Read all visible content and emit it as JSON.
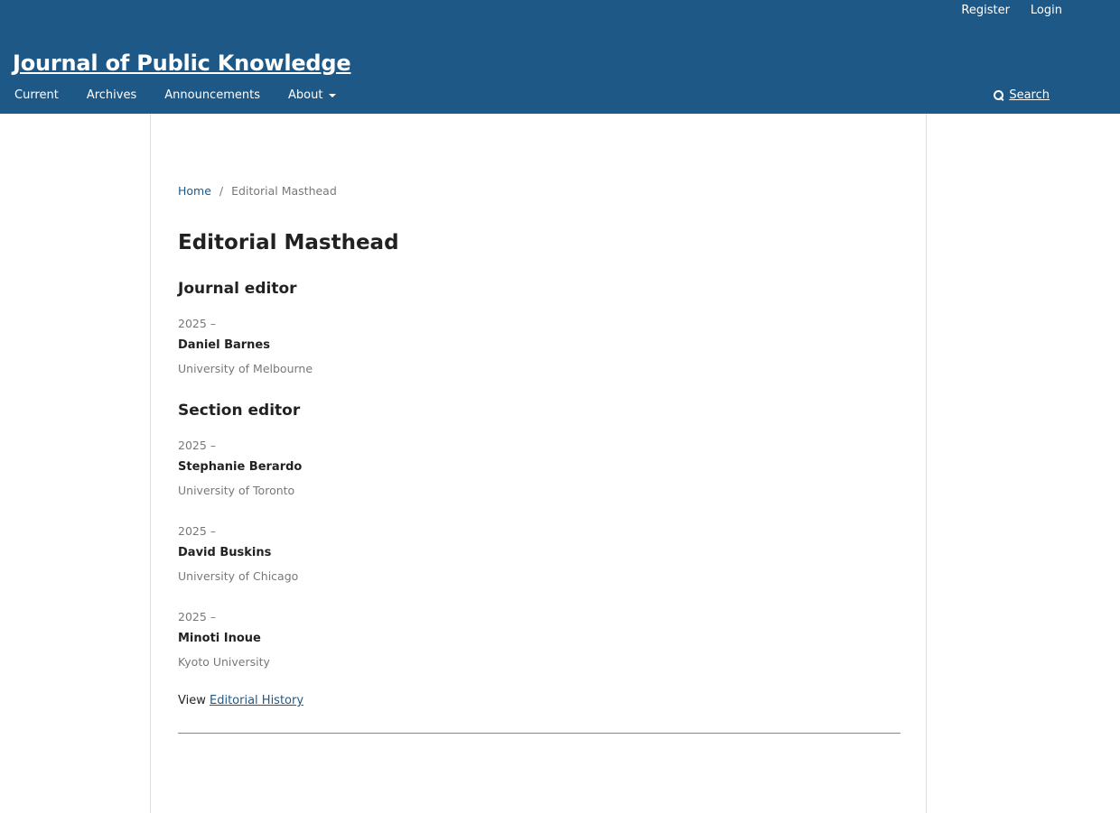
{
  "user_nav": {
    "register": "Register",
    "login": "Login"
  },
  "site": {
    "title": "Journal of Public Knowledge"
  },
  "primary_nav": {
    "current": "Current",
    "archives": "Archives",
    "announcements": "Announcements",
    "about": "About",
    "search": "Search"
  },
  "breadcrumb": {
    "home": "Home",
    "separator": "/",
    "current": "Editorial Masthead"
  },
  "page_title": "Editorial Masthead",
  "journal_editor": {
    "heading": "Journal editor",
    "people": [
      {
        "date": "2025 –",
        "name": "Daniel Barnes",
        "affiliation": "University of Melbourne"
      }
    ]
  },
  "section_editor": {
    "heading": "Section editor",
    "people": [
      {
        "date": "2025 –",
        "name": "Stephanie Berardo",
        "affiliation": "University of Toronto"
      },
      {
        "date": "2025 –",
        "name": "David Buskins",
        "affiliation": "University of Chicago"
      },
      {
        "date": "2025 –",
        "name": "Minoti Inoue",
        "affiliation": "Kyoto University"
      }
    ]
  },
  "history": {
    "prefix": "View",
    "link": "Editorial History"
  },
  "colors": {
    "header_bg": "#1e5887",
    "link": "#1e5887",
    "text": "#222222",
    "muted": "#666666"
  },
  "icons": {
    "search": "search-icon",
    "about_dropdown": "caret-down-icon"
  }
}
